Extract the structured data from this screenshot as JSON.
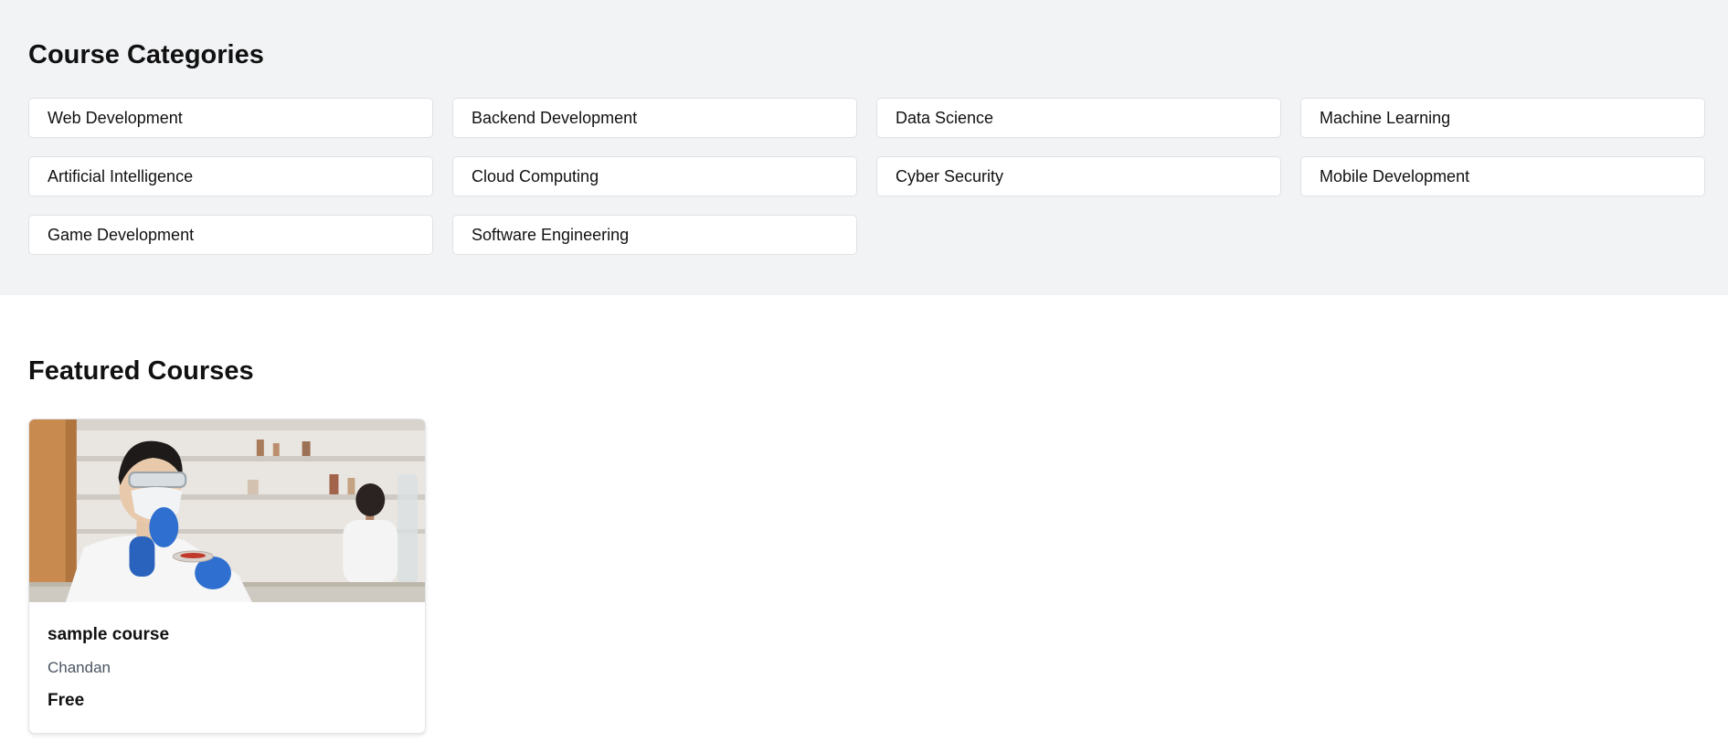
{
  "categories": {
    "title": "Course Categories",
    "items": [
      {
        "label": "Web Development"
      },
      {
        "label": "Backend Development"
      },
      {
        "label": "Data Science"
      },
      {
        "label": "Machine Learning"
      },
      {
        "label": "Artificial Intelligence"
      },
      {
        "label": "Cloud Computing"
      },
      {
        "label": "Cyber Security"
      },
      {
        "label": "Mobile Development"
      },
      {
        "label": "Game Development"
      },
      {
        "label": "Software Engineering"
      }
    ]
  },
  "featured": {
    "title": "Featured Courses",
    "courses": [
      {
        "image_desc": "lab-scientist-photo",
        "title": "sample course",
        "author": "Chandan",
        "price": "Free"
      }
    ]
  },
  "colors": {
    "section_bg": "#f2f3f5",
    "card_border": "#dfe2e6",
    "muted_text": "#4b5563"
  }
}
